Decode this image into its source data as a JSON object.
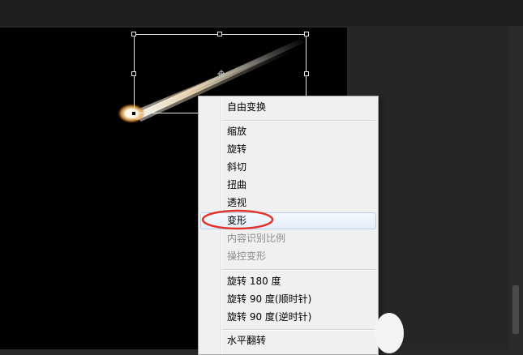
{
  "context_menu": {
    "items": [
      {
        "label": "自由变换",
        "enabled": true
      },
      {
        "label": "缩放",
        "enabled": true
      },
      {
        "label": "旋转",
        "enabled": true
      },
      {
        "label": "斜切",
        "enabled": true
      },
      {
        "label": "扭曲",
        "enabled": true
      },
      {
        "label": "透视",
        "enabled": true
      },
      {
        "label": "变形",
        "enabled": true,
        "highlighted": true
      },
      {
        "label": "内容识别比例",
        "enabled": false
      },
      {
        "label": "操控变形",
        "enabled": false
      },
      {
        "label": "旋转 180 度",
        "enabled": true
      },
      {
        "label": "旋转 90 度(顺时针)",
        "enabled": true
      },
      {
        "label": "旋转 90 度(逆时针)",
        "enabled": true
      },
      {
        "label": "水平翻转",
        "enabled": true
      }
    ]
  },
  "annotation": {
    "color": "#e0342b",
    "shape": "ellipse"
  },
  "artwork": {
    "subject": "comet",
    "glow_color": "#f2c27a",
    "background": "#000000"
  }
}
